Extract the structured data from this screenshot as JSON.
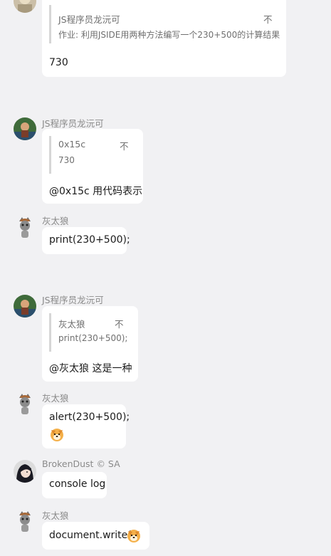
{
  "messages": [
    {
      "sender": "",
      "quote": {
        "name": "JS程序员龙沅可",
        "flag": "不",
        "text": "作业: 利用JSIDE用两种方法编写一个230+500的计算结果"
      },
      "text": "730"
    },
    {
      "sender": "JS程序员龙沅可",
      "quote": {
        "name": "0x15c",
        "flag": "不",
        "text": "730"
      },
      "text": "@0x15c 用代码表示"
    },
    {
      "sender": "灰太狼",
      "text": "print(230+500);"
    },
    {
      "sender": "JS程序员龙沅可",
      "quote": {
        "name": "灰太狼",
        "flag": "不",
        "text": "print(230+500);"
      },
      "text": "@灰太狼 这是一种"
    },
    {
      "sender": "灰太狼",
      "text": "alert(230+500);",
      "emoji": "dog-face-emoji"
    },
    {
      "sender": "BrokenDust",
      "sender_badge": "© SA",
      "text": "console log"
    },
    {
      "sender": "灰太狼",
      "text": "document.write()",
      "emoji": "dog-face-emoji"
    }
  ],
  "colors": {
    "background": "#f1f1f3",
    "bubble": "#ffffff",
    "sender": "#8a8a8a",
    "quote_bar": "#d6d6d6"
  }
}
